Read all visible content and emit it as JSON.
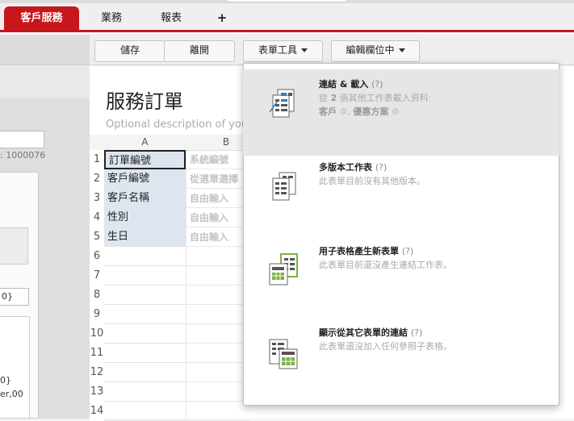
{
  "tabs": [
    {
      "label": "客戶服務",
      "active": true
    },
    {
      "label": "業務",
      "active": false
    },
    {
      "label": "報表",
      "active": false
    },
    {
      "label": "+",
      "active": false
    }
  ],
  "left": {
    "id_label": ": 1000076",
    "field_text_1": "0}",
    "field_text_2": "0}",
    "field_text_3": "er,00"
  },
  "toolbar": {
    "save_label": "儲存",
    "leave_label": "離開",
    "form_tools_label": "表單工具",
    "edit_fields_label": "編輯欄位中"
  },
  "form": {
    "title": "服務訂單",
    "description": "Optional description of your"
  },
  "grid": {
    "col_a": "A",
    "col_b": "B",
    "rows": [
      {
        "num": "1",
        "a": "訂單編號",
        "b": "系統編號"
      },
      {
        "num": "2",
        "a": "客戶編號",
        "b": "從選單選擇"
      },
      {
        "num": "3",
        "a": "客戶名稱",
        "b": "自由輸入"
      },
      {
        "num": "4",
        "a": "性別",
        "b": "自由輸入"
      },
      {
        "num": "5",
        "a": "生日",
        "b": "自由輸入"
      },
      {
        "num": "6",
        "a": "",
        "b": ""
      },
      {
        "num": "7",
        "a": "",
        "b": ""
      },
      {
        "num": "8",
        "a": "",
        "b": ""
      },
      {
        "num": "9",
        "a": "",
        "b": ""
      },
      {
        "num": "10",
        "a": "",
        "b": ""
      },
      {
        "num": "11",
        "a": "",
        "b": ""
      },
      {
        "num": "12",
        "a": "",
        "b": ""
      },
      {
        "num": "13",
        "a": "",
        "b": ""
      },
      {
        "num": "14",
        "a": "",
        "b": ""
      }
    ]
  },
  "menu": {
    "items": [
      {
        "title": "連結 & 載入",
        "help": "(?)",
        "sub_prefix": "從",
        "sub_count": "2",
        "sub_suffix": "張其他工作表載入資料:",
        "sub_line2_a": "客戶",
        "sub_line2_sep": ", ",
        "sub_line2_b": "優惠方案",
        "icon": "link-load-icon"
      },
      {
        "title": "多版本工作表",
        "help": "(?)",
        "sub": "此表單目前沒有其他版本。",
        "icon": "multi-version-icon"
      },
      {
        "title": "用子表格產生新表單",
        "help": "(?)",
        "sub": "此表單目前還沒產生連結工作表。",
        "icon": "subtable-form-icon"
      },
      {
        "title": "顯示從其它表單的連結",
        "help": "(?)",
        "sub": "此表單還沒加入任何參照子表格。",
        "icon": "show-links-icon"
      }
    ]
  },
  "colors": {
    "brand_red": "#c8161d",
    "accent_blue": "#2a7fc0",
    "accent_green": "#7cb342"
  }
}
